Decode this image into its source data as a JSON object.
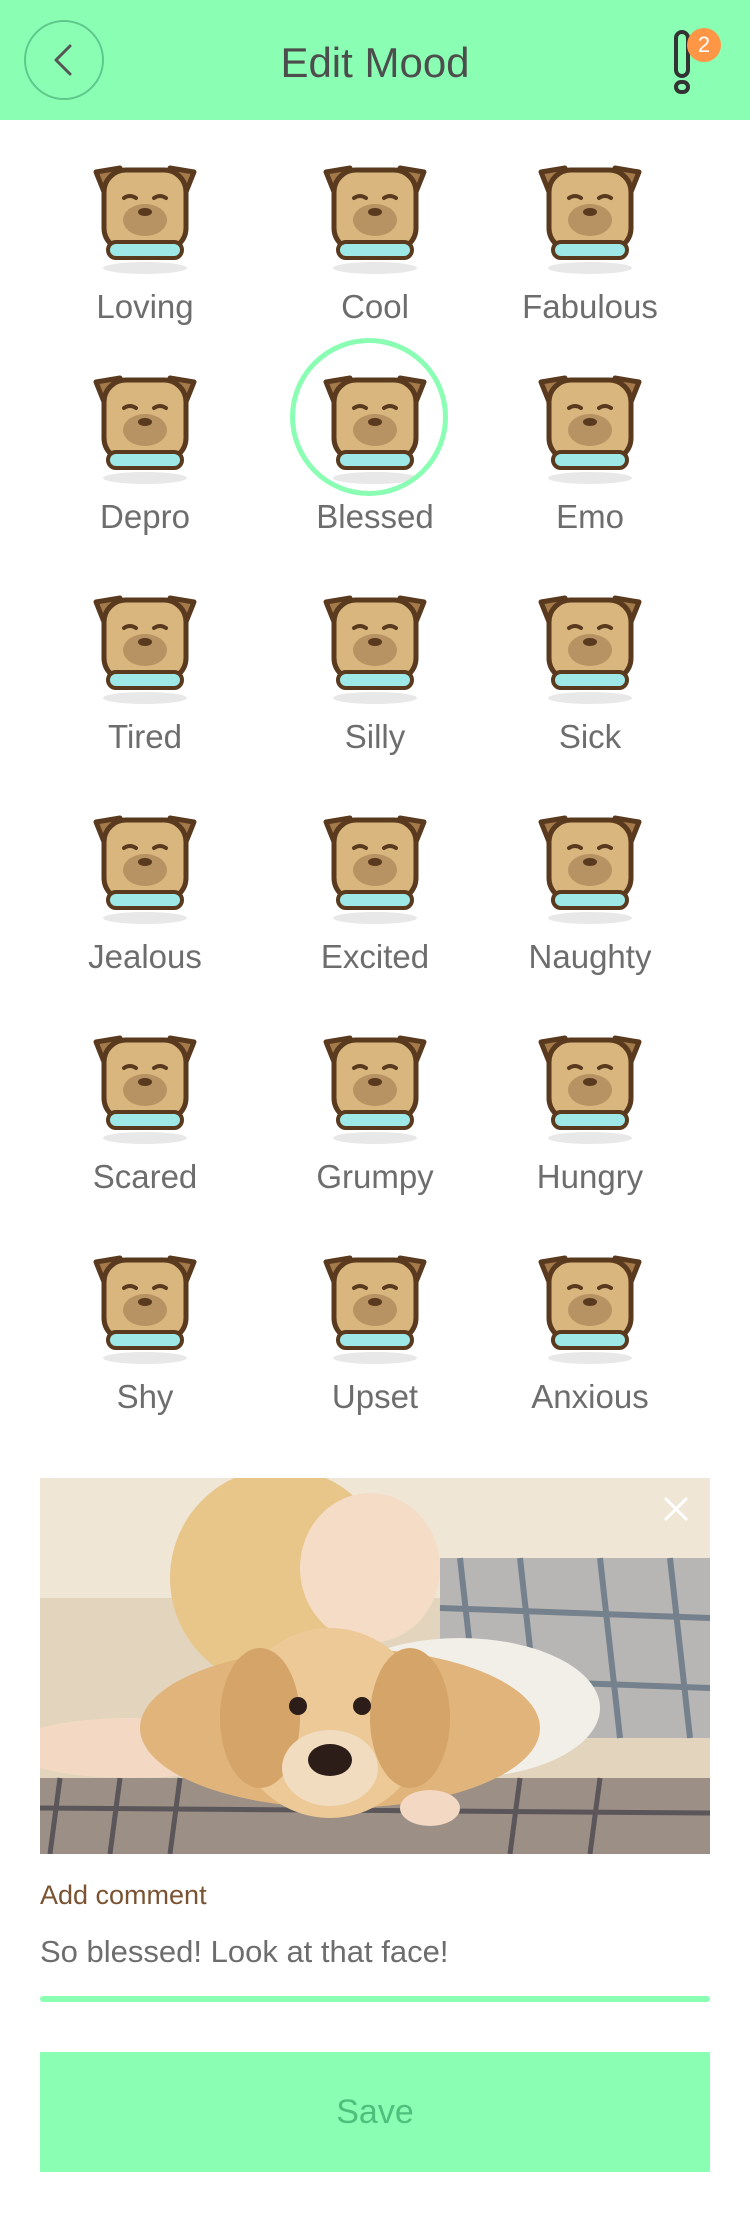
{
  "header": {
    "title": "Edit Mood",
    "notification_count": "2"
  },
  "moods": [
    {
      "label": "Loving",
      "icon": "loving-dog-icon"
    },
    {
      "label": "Cool",
      "icon": "cool-dog-icon"
    },
    {
      "label": "Fabulous",
      "icon": "fabulous-dog-icon"
    },
    {
      "label": "Depro",
      "icon": "depro-dog-icon"
    },
    {
      "label": "Blessed",
      "icon": "blessed-dog-icon",
      "selected": true
    },
    {
      "label": "Emo",
      "icon": "emo-dog-icon"
    },
    {
      "label": "Tired",
      "icon": "tired-dog-icon"
    },
    {
      "label": "Silly",
      "icon": "silly-dog-icon"
    },
    {
      "label": "Sick",
      "icon": "sick-dog-icon"
    },
    {
      "label": "Jealous",
      "icon": "jealous-dog-icon"
    },
    {
      "label": "Excited",
      "icon": "excited-dog-icon"
    },
    {
      "label": "Naughty",
      "icon": "naughty-dog-icon"
    },
    {
      "label": "Scared",
      "icon": "scared-dog-icon"
    },
    {
      "label": "Grumpy",
      "icon": "grumpy-dog-icon"
    },
    {
      "label": "Hungry",
      "icon": "hungry-dog-icon"
    },
    {
      "label": "Shy",
      "icon": "shy-dog-icon"
    },
    {
      "label": "Upset",
      "icon": "upset-dog-icon"
    },
    {
      "label": "Anxious",
      "icon": "anxious-dog-icon"
    }
  ],
  "comment": {
    "label": "Add comment",
    "value": "So blessed! Look at that face!"
  },
  "save_label": "Save",
  "colors": {
    "accent": "#8affb4",
    "badge": "#ff9646",
    "dog_fur": "#d9b67e",
    "dog_outline": "#5a3a1e",
    "collar": "#9fe8e8"
  }
}
